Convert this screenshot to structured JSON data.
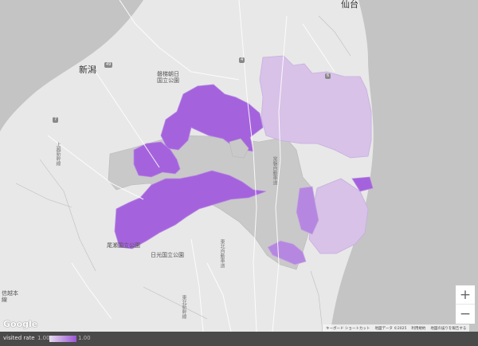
{
  "map": {
    "cities": {
      "sendai": "仙台",
      "niigata": "新潟"
    },
    "parks": {
      "bandai": "磐梯朝日\n国立公園",
      "oze": "尾瀬国立公園",
      "nikko": "日光国立公園"
    },
    "roads": {
      "kanetsu": "上越新幹線",
      "joban": "常磐自動車道",
      "tohoku": "東北自動車道",
      "shinkansen": "東北新幹線"
    },
    "partial_labels": {
      "west_low": "信越本\n線"
    },
    "route_badges": [
      "49",
      "7",
      "4",
      "6"
    ]
  },
  "controls": {
    "zoom_in": "+",
    "zoom_out": "−"
  },
  "attribution": {
    "google": "Google",
    "shortcuts": "キーボード ショートカット",
    "map_data": "地図データ ©2025",
    "terms": "利用規約",
    "report": "地図の誤りを報告する"
  },
  "legend": {
    "title": "visited rate",
    "min": "1.00",
    "max": "1.00",
    "colors": {
      "low": "#e6dcee",
      "high": "#9a55d4"
    }
  },
  "colors": {
    "land": "#e8e8e8",
    "sea": "#c4c4c4",
    "grey_region": "#c9c9c9",
    "purple_dark": "#a463dc",
    "purple_mid": "#b687e0",
    "purple_light": "#d8c2e8"
  }
}
